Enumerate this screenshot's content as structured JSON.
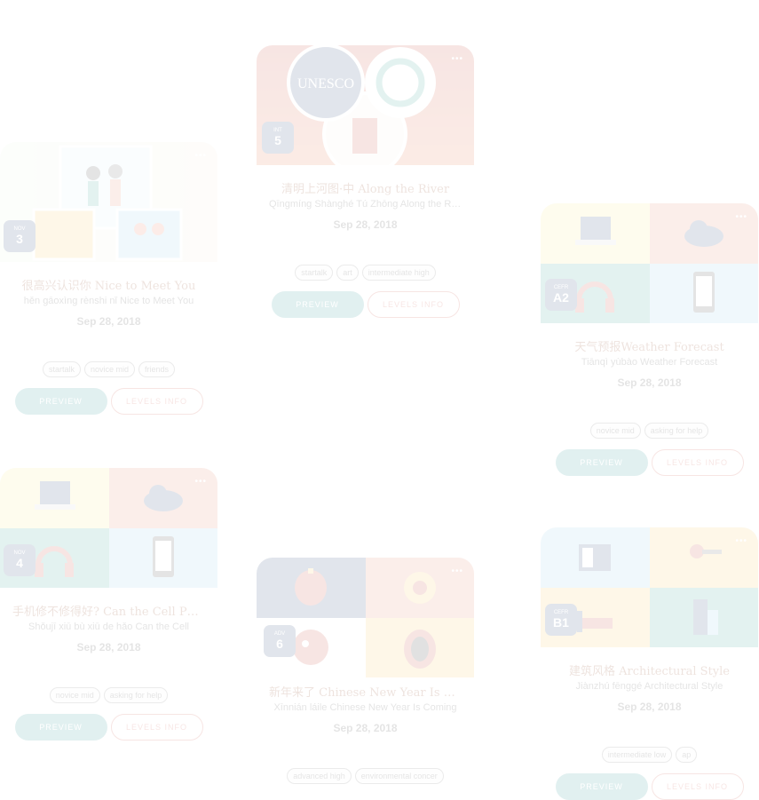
{
  "cards": [
    {
      "id": "c1",
      "title": "很高兴认识你 Nice to Meet You",
      "subtitle": "hěn gāoxìng rènshi nǐ Nice to Meet You",
      "badge_label": "NOV",
      "badge_value": "3",
      "date": "Sep 28, 2018",
      "tags": [
        "startalk",
        "novice mid",
        "friends"
      ],
      "preview_label": "PREVIEW",
      "levels_label": "LEVELS INFO"
    },
    {
      "id": "c2",
      "title": "清明上河图·中 Along the River",
      "subtitle": "Qīngmíng Shànghé Tú Zhōng Along the River",
      "badge_label": "INT",
      "badge_value": "5",
      "date": "Sep 28, 2018",
      "tags": [
        "startalk",
        "art",
        "intermediate high"
      ],
      "preview_label": "PREVIEW",
      "levels_label": "LEVELS INFO"
    },
    {
      "id": "c3",
      "title": "天气预报Weather Forecast",
      "subtitle": "Tiānqì yùbào Weather Forecast",
      "badge_label": "CEFR",
      "badge_value": "A2",
      "date": "Sep 28, 2018",
      "tags": [
        "novice mid",
        "asking for help"
      ],
      "preview_label": "PREVIEW",
      "levels_label": "LEVELS INFO"
    },
    {
      "id": "c4",
      "title": "手机修不修得好? Can the Cell Phone",
      "subtitle": "Shǒujī xiū bù xiū de hǎo Can the Cell",
      "badge_label": "NOV",
      "badge_value": "4",
      "date": "Sep 28, 2018",
      "tags": [
        "novice mid",
        "asking for help"
      ],
      "preview_label": "PREVIEW",
      "levels_label": "LEVELS INFO"
    },
    {
      "id": "c5",
      "title": "新年来了 Chinese New Year Is Coming",
      "subtitle": "Xīnnián láile Chinese New Year Is Coming",
      "badge_label": "ADV",
      "badge_value": "6",
      "date": "Sep 28, 2018",
      "tags": [
        "advanced high",
        "environmental concer"
      ],
      "preview_label": "PREVIEW",
      "levels_label": "LEVELS INFO"
    },
    {
      "id": "c6",
      "title": "建筑风格 Architectural Style",
      "subtitle": "Jiànzhú fēnggé Architectural Style",
      "badge_label": "CEFR",
      "badge_value": "B1",
      "date": "Sep 28, 2018",
      "tags": [
        "intermediate low",
        "ap"
      ],
      "preview_label": "PREVIEW",
      "levels_label": "LEVELS INFO"
    }
  ],
  "colors": {
    "teal": "#1c8f8f",
    "red": "#c0392b",
    "navy": "#1b3a6b",
    "title": "#7a2a00"
  }
}
